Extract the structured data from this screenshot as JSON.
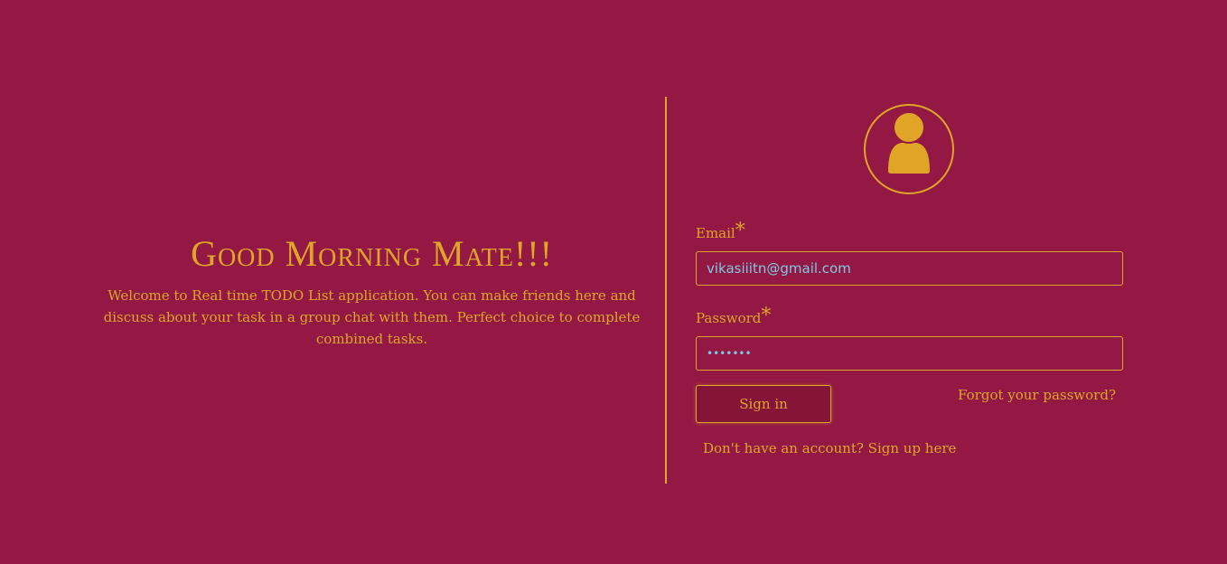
{
  "hero": {
    "headline": "Good Morning Mate!!!",
    "intro": "Welcome to Real time TODO List application. You can make friends here and discuss about your task in a group chat with them. Perfect choice to complete combined tasks."
  },
  "form": {
    "avatar_icon": "user-icon",
    "email_label": "Email",
    "email_value": "vikasiiitn@gmail.com",
    "password_label": "Password",
    "password_value": "•••••••",
    "required_mark": "*",
    "signin_label": "Sign in",
    "forgot_label": "Forgot your password?",
    "signup_label": "Don't have an account? Sign up here"
  },
  "colors": {
    "background": "#931944",
    "accent": "#e0a526",
    "input_text": "#7ec8e3"
  }
}
